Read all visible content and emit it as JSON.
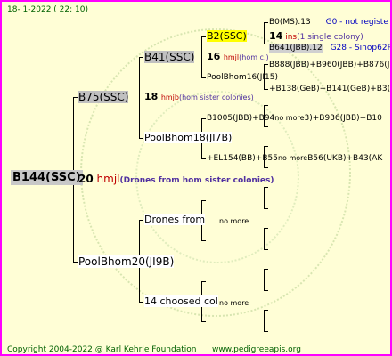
{
  "header": {
    "text": "18-   1-2022  (  22:  10)"
  },
  "footer": {
    "copyright": "Copyright 2004-2022 @ Karl Kehrle Foundation",
    "url": "www.pedigreeapis.org"
  },
  "root": {
    "label": "B144(SSC)",
    "gen": "20",
    "gen_code": "hmjl",
    "gen_note": "(Drones from hom sister colonies)"
  },
  "father": {
    "label": "B75(SSC)",
    "gen": "18",
    "gen_code": "hmjb",
    "gen_note": "(hom sister colonies)"
  },
  "ff": {
    "label": "B41(SSC)",
    "gen": "16",
    "gen_code": "hmjl",
    "gen_note": "(hom c.)"
  },
  "fff": {
    "label": "B2(SSC)",
    "gen": "14",
    "gen_code": "ins",
    "gen_note": "(1 single colony)"
  },
  "ffff": {
    "label": "B0(MS).13",
    "note": "G0 - not registe"
  },
  "fffm": {
    "label": "B641(JBB).12",
    "note": "G28 - Sinop62R"
  },
  "ffm": {
    "label": "PoolBhom16(JI15)"
  },
  "ffmf": {
    "label": "B888(JBB)+B960(JBB)+B876(JBB"
  },
  "ffmm": {
    "label": "+B138(GeB)+B141(GeB)+B3(SS"
  },
  "fm": {
    "label": "PoolBhom18(JI7B)"
  },
  "fmf": {
    "label": "B1005(JBB)+B94",
    "extra": "no more",
    "tail": "3)+B936(JBB)+B10"
  },
  "fmm": {
    "label": "+EL154(BB)+B55",
    "extra": "no more",
    "tail": "B56(UKB)+B43(AK"
  },
  "mother": {
    "label": "PoolBhom20(JI9B)"
  },
  "mf": {
    "label": "Drones from",
    "extra": "no more"
  },
  "mm": {
    "label": "14 choosed col",
    "extra": "no more"
  }
}
